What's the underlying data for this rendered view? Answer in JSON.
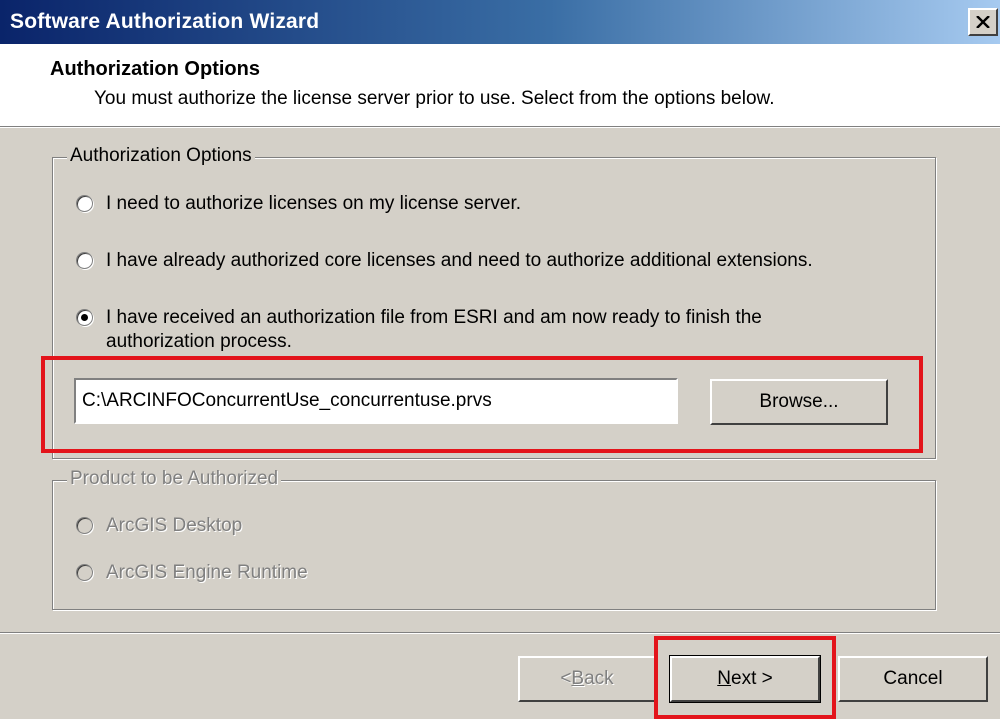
{
  "window": {
    "title": "Software Authorization Wizard",
    "close_label": "×"
  },
  "header": {
    "title": "Authorization Options",
    "subtitle": "You must authorize the license server prior to use. Select from the options below."
  },
  "auth_options": {
    "legend": "Authorization Options",
    "options": [
      {
        "label": "I need to authorize licenses on my license server.",
        "selected": false
      },
      {
        "label": "I have already authorized core licenses and need to authorize additional extensions.",
        "selected": false
      },
      {
        "label_line1": "I have received an authorization file from ESRI and am now ready to finish the",
        "label_line2": "authorization process.",
        "selected": true
      }
    ],
    "file_path": "C:\\ARCINFOConcurrentUse_concurrentuse.prvs",
    "browse_label": "Browse..."
  },
  "product": {
    "legend": "Product to be Authorized",
    "options": [
      {
        "label": "ArcGIS Desktop",
        "enabled": false
      },
      {
        "label": "ArcGIS Engine Runtime",
        "enabled": false
      }
    ]
  },
  "footer": {
    "back_mnemonic": "B",
    "back_rest": "ack",
    "back_prefix": "< ",
    "next_mnemonic": "N",
    "next_rest": "ext >",
    "cancel_label": "Cancel"
  },
  "colors": {
    "highlight": "#e3141b",
    "titlebar_start": "#0a246a",
    "face": "#d4d0c8"
  }
}
